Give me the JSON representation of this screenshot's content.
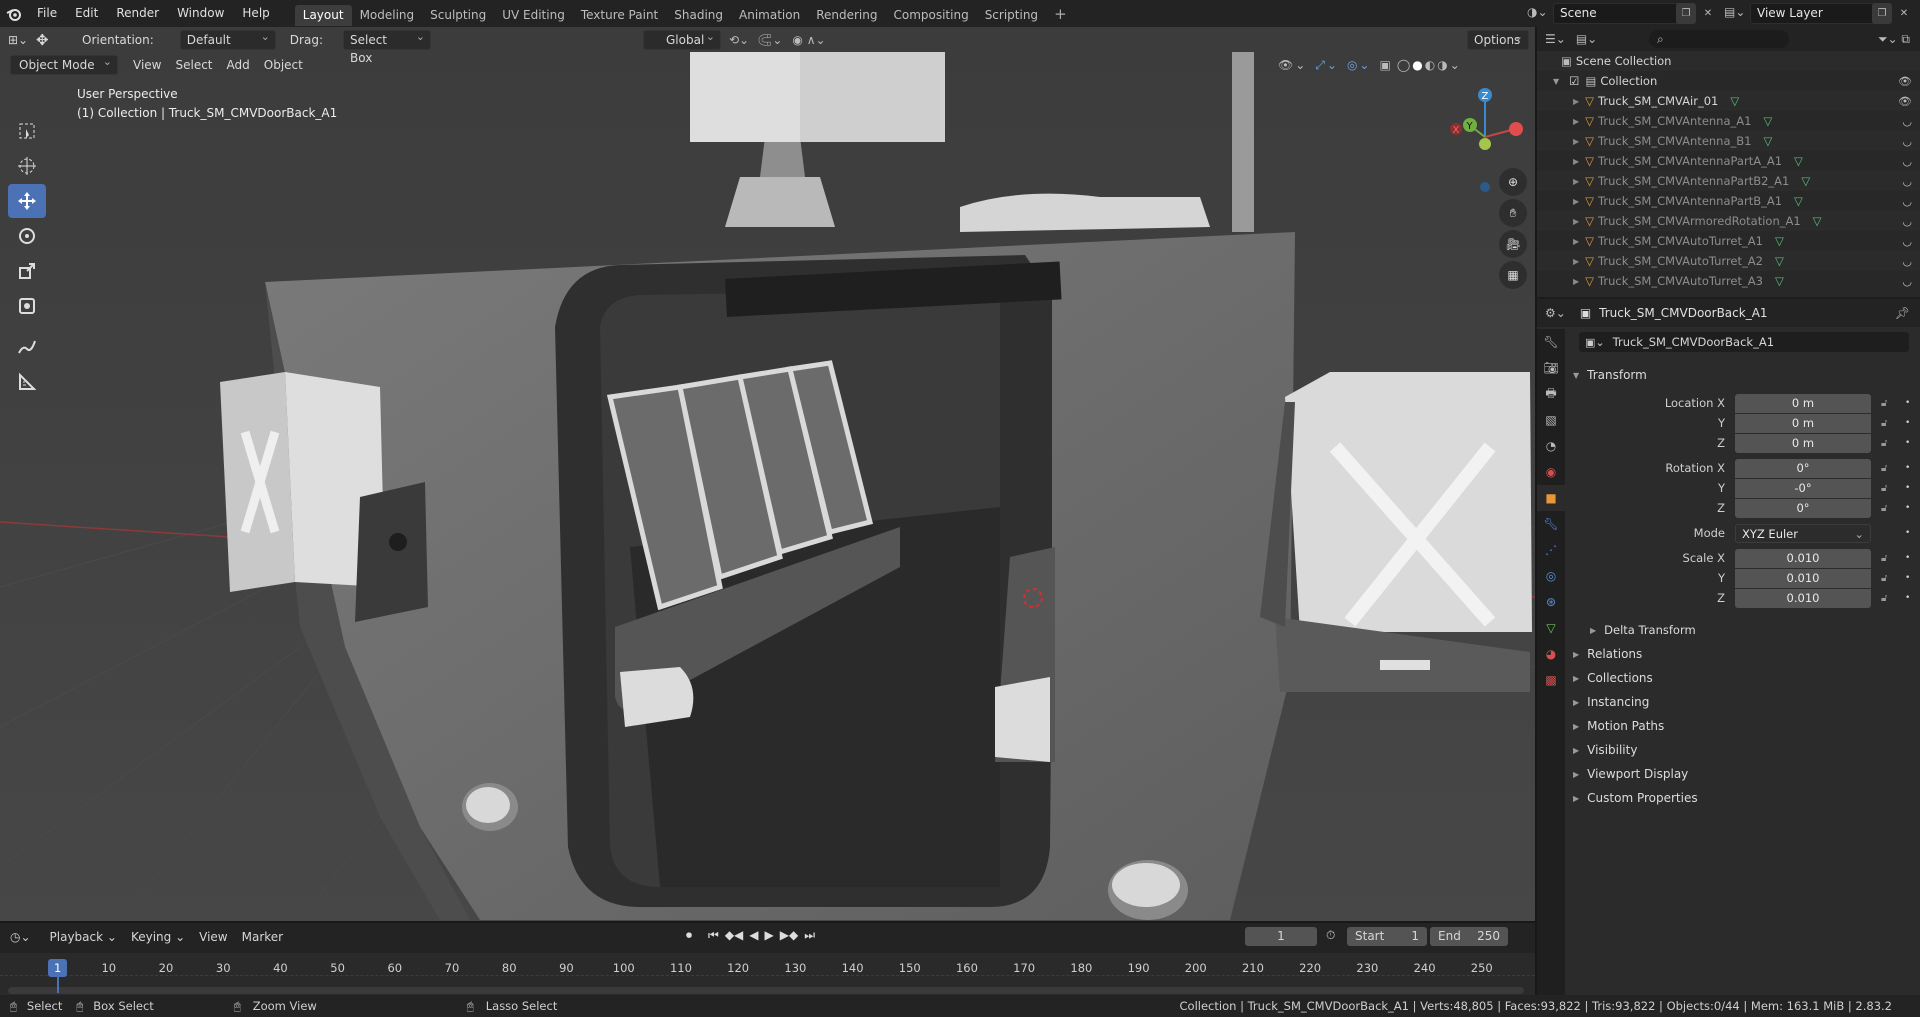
{
  "topbar": {
    "menus": [
      "File",
      "Edit",
      "Render",
      "Window",
      "Help"
    ],
    "workspaces": [
      "Layout",
      "Modeling",
      "Sculpting",
      "UV Editing",
      "Texture Paint",
      "Shading",
      "Animation",
      "Rendering",
      "Compositing",
      "Scripting"
    ],
    "active_workspace": "Layout",
    "scene": "Scene",
    "view_layer": "View Layer"
  },
  "viewport_header": {
    "orientation_label": "Orientation:",
    "orientation_value": "Default",
    "drag_label": "Drag:",
    "drag_value": "Select Box",
    "transform_orientation": "Global",
    "options": "Options"
  },
  "viewport_header2": {
    "mode": "Object Mode",
    "menus": [
      "View",
      "Select",
      "Add",
      "Object"
    ]
  },
  "viewport": {
    "perspective": "User Perspective",
    "collection_info": "(1) Collection | Truck_SM_CMVDoorBack_A1",
    "axes": {
      "x": "X",
      "y": "Y",
      "z": "Z"
    }
  },
  "outliner": {
    "search_placeholder": "",
    "scene_collection": "Scene Collection",
    "collection": "Collection",
    "items": [
      {
        "name": "Truck_SM_CMVAir_01",
        "dim": false
      },
      {
        "name": "Truck_SM_CMVAntenna_A1",
        "dim": true
      },
      {
        "name": "Truck_SM_CMVAntenna_B1",
        "dim": true
      },
      {
        "name": "Truck_SM_CMVAntennaPartA_A1",
        "dim": true
      },
      {
        "name": "Truck_SM_CMVAntennaPartB2_A1",
        "dim": true
      },
      {
        "name": "Truck_SM_CMVAntennaPartB_A1",
        "dim": true
      },
      {
        "name": "Truck_SM_CMVArmoredRotation_A1",
        "dim": true
      },
      {
        "name": "Truck_SM_CMVAutoTurret_A1",
        "dim": true
      },
      {
        "name": "Truck_SM_CMVAutoTurret_A2",
        "dim": true
      },
      {
        "name": "Truck_SM_CMVAutoTurret_A3",
        "dim": true
      }
    ]
  },
  "properties": {
    "object_name": "Truck_SM_CMVDoorBack_A1",
    "object_field": "Truck_SM_CMVDoorBack_A1",
    "transform_label": "Transform",
    "location": {
      "label_x": "Location X",
      "x": "0 m",
      "y": "0 m",
      "z": "0 m"
    },
    "rotation": {
      "label_x": "Rotation X",
      "x": "0°",
      "y": "-0°",
      "z": "0°"
    },
    "mode_label": "Mode",
    "mode_value": "XYZ Euler",
    "scale": {
      "label_x": "Scale X",
      "x": "0.010",
      "y": "0.010",
      "z": "0.010"
    },
    "axis_y": "Y",
    "axis_z": "Z",
    "delta_transform": "Delta Transform",
    "panels": [
      "Relations",
      "Collections",
      "Instancing",
      "Motion Paths",
      "Visibility",
      "Viewport Display",
      "Custom Properties"
    ]
  },
  "timeline": {
    "menus": [
      "Playback",
      "Keying",
      "View",
      "Marker"
    ],
    "current_frame": "1",
    "start_label": "Start",
    "start": "1",
    "end_label": "End",
    "end": "250",
    "ruler": [
      "1",
      "10",
      "20",
      "30",
      "40",
      "50",
      "60",
      "70",
      "80",
      "90",
      "100",
      "110",
      "120",
      "130",
      "140",
      "150",
      "160",
      "170",
      "180",
      "190",
      "200",
      "210",
      "220",
      "230",
      "240",
      "250"
    ]
  },
  "statusbar": {
    "select": "Select",
    "box_select": "Box Select",
    "zoom_view": "Zoom View",
    "lasso_select": "Lasso Select",
    "stats": "Collection | Truck_SM_CMVDoorBack_A1 | Verts:48,805 | Faces:93,822 | Tris:93,822 | Objects:0/44 | Mem: 163.1 MiB | 2.83.2"
  }
}
